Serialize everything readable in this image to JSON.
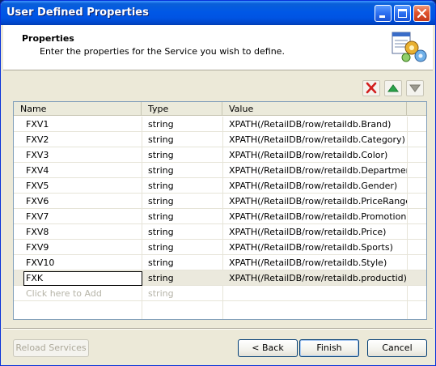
{
  "window": {
    "title": "User Defined Properties"
  },
  "header": {
    "title": "Properties",
    "description": "Enter the properties for the Service you wish to define."
  },
  "grid": {
    "columns": [
      "Name",
      "Type",
      "Value"
    ],
    "rows": [
      {
        "name": "FXV1",
        "type": "string",
        "value": "XPATH(/RetailDB/row/retaildb.Brand)"
      },
      {
        "name": "FXV2",
        "type": "string",
        "value": "XPATH(/RetailDB/row/retaildb.Category)"
      },
      {
        "name": "FXV3",
        "type": "string",
        "value": "XPATH(/RetailDB/row/retaildb.Color)"
      },
      {
        "name": "FXV4",
        "type": "string",
        "value": "XPATH(/RetailDB/row/retaildb.Department)"
      },
      {
        "name": "FXV5",
        "type": "string",
        "value": "XPATH(/RetailDB/row/retaildb.Gender)"
      },
      {
        "name": "FXV6",
        "type": "string",
        "value": "XPATH(/RetailDB/row/retaildb.PriceRange)"
      },
      {
        "name": "FXV7",
        "type": "string",
        "value": "XPATH(/RetailDB/row/retaildb.Promotion)"
      },
      {
        "name": "FXV8",
        "type": "string",
        "value": "XPATH(/RetailDB/row/retaildb.Price)"
      },
      {
        "name": "FXV9",
        "type": "string",
        "value": "XPATH(/RetailDB/row/retaildb.Sports)"
      },
      {
        "name": "FXV10",
        "type": "string",
        "value": "XPATH(/RetailDB/row/retaildb.Style)"
      }
    ],
    "editing_row": {
      "name": "FXK",
      "type": "string",
      "value": "XPATH(/RetailDB/row/retaildb.productid)"
    },
    "add_row": {
      "name": "Click here to Add",
      "type": "string"
    }
  },
  "buttons": {
    "reload": "Reload Services",
    "back": "< Back",
    "finish": "Finish",
    "cancel": "Cancel"
  },
  "icons": {
    "delete": "delete-x-icon",
    "move_up": "arrow-up-icon",
    "move_down": "arrow-down-icon",
    "wizard": "properties-gears-icon"
  },
  "colors": {
    "titlebar": "#0054e3",
    "delete_icon": "#d21f1f",
    "up_arrow": "#2aa34a",
    "down_arrow": "#9c9a90"
  }
}
